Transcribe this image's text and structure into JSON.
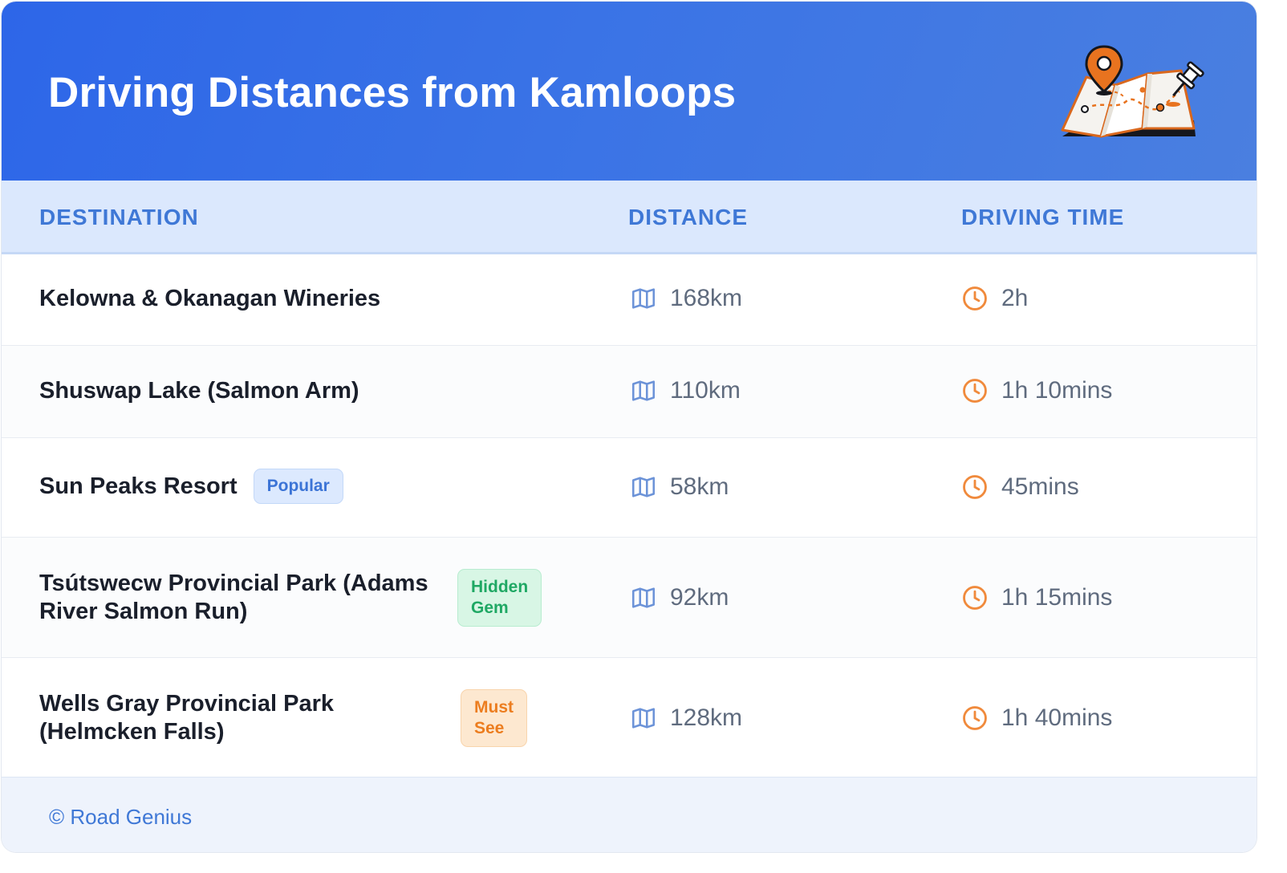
{
  "header": {
    "title": "Driving Distances from Kamloops",
    "illustration": "map-with-pins-icon"
  },
  "table": {
    "columns": [
      "DESTINATION",
      "DISTANCE",
      "DRIVING TIME"
    ],
    "rows": [
      {
        "destination": "Kelowna & Okanagan Wineries",
        "badge": "",
        "distance": "168km",
        "time": "2h"
      },
      {
        "destination": "Shuswap Lake (Salmon Arm)",
        "badge": "",
        "distance": "110km",
        "time": "1h 10mins"
      },
      {
        "destination": "Sun Peaks Resort",
        "badge": "Popular",
        "distance": "58km",
        "time": "45mins"
      },
      {
        "destination_line1": "Tsútswecw Provincial Park (Adams",
        "destination_line2": "River Salmon Run)",
        "badge_line1": "Hidden",
        "badge_line2": "Gem",
        "distance": "92km",
        "time": "1h 15mins"
      },
      {
        "destination_line1": "Wells Gray Provincial Park",
        "destination_line2": "(Helmcken Falls)",
        "badge_line1": "Must",
        "badge_line2": "See",
        "distance": "128km",
        "time": "1h 40mins"
      }
    ]
  },
  "icons": {
    "distance": "map-icon",
    "time": "clock-icon"
  },
  "colors": {
    "header_start": "#2d66e8",
    "header_end": "#4a7fe0",
    "accent_blue": "#3f78d6",
    "icon_orange": "#f08a3c",
    "popular_badge": "#dce9fe",
    "hidden_gem_badge": "#d8f6e5",
    "must_see_badge": "#fde8d0"
  },
  "footer": {
    "text": "© Road Genius"
  }
}
